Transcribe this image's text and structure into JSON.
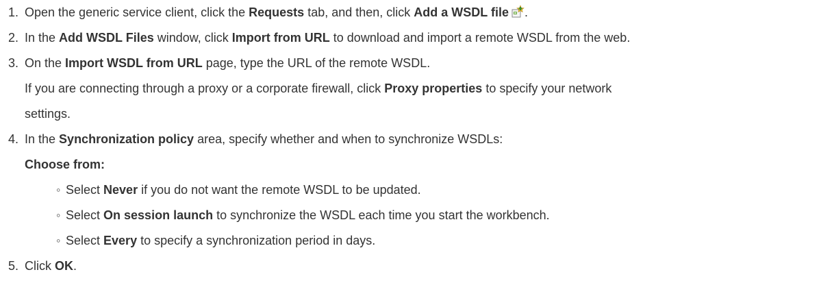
{
  "steps": {
    "s1": {
      "num": "1.",
      "t1": "Open the generic service client, click the ",
      "b1": "Requests",
      "t2": " tab, and then, click  ",
      "b2": "Add a WSDL file",
      "t3": ".",
      "icon": "add-wsdl-file-icon"
    },
    "s2": {
      "num": "2.",
      "t1": "In the ",
      "b1": "Add WSDL Files",
      "t2": " window, click ",
      "b2": "Import from URL",
      "t3": " to download and import a remote WSDL from the web."
    },
    "s3": {
      "num": "3.",
      "t1": "On the ",
      "b1": "Import WSDL from URL",
      "t2": " page, type the URL of the remote WSDL.",
      "p1": "If you are connecting through a proxy or a corporate firewall, click ",
      "pb": "Proxy properties",
      "p2": " to specify your network",
      "p3": "settings."
    },
    "s4": {
      "num": "4.",
      "t1": "In the ",
      "b1": "Synchronization policy",
      "t2": " area, specify whether and when to synchronize WSDLs:",
      "choose": "Choose from:",
      "bullet": "◦",
      "items": [
        {
          "pre": "Select ",
          "bold": "Never",
          "post": " if you do not want the remote WSDL to be updated."
        },
        {
          "pre": "Select ",
          "bold": "On session launch",
          "post": " to synchronize the WSDL each time you start the workbench."
        },
        {
          "pre": "Select ",
          "bold": "Every",
          "post": " to specify a synchronization period in days."
        }
      ]
    },
    "s5": {
      "num": "5.",
      "t1": "Click ",
      "b1": "OK",
      "t2": "."
    }
  }
}
